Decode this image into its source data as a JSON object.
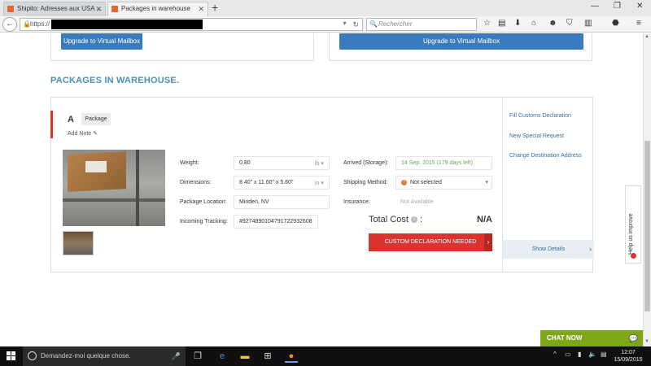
{
  "browser": {
    "tabs": [
      {
        "label": "Shipito: Adresses aux USA ..."
      },
      {
        "label": "Packages in warehouse"
      }
    ],
    "url_prefix": "https://",
    "search_placeholder": "Rechercher"
  },
  "page": {
    "upgrade_buttons": [
      "Upgrade to Virtual Mailbox",
      "Upgrade to Virtual Mailbox"
    ],
    "section_title": "PACKAGES IN WAREHOUSE.",
    "package": {
      "letter": "A",
      "type": "Package",
      "add_note": "Add Note",
      "fields": {
        "weight_label": "Weight:",
        "weight_value": "0.80",
        "weight_unit": "lb",
        "dimensions_label": "Dimensions:",
        "dimensions_value": "8.40\" x 11.60\" x 5.60\"",
        "dimensions_unit": "in",
        "location_label": "Package Location:",
        "location_value": "Minden, NV",
        "tracking_label": "Incoming Tracking:",
        "tracking_value": "#9274890104791722932608",
        "arrived_label": "Arrived (Storage):",
        "arrived_value": "14 Sep. 2015 (179 days left)",
        "shipping_label": "Shipping Method:",
        "shipping_value": "Not selected",
        "insurance_label": "Insurance:",
        "insurance_value": "Not Available"
      },
      "total_cost_label": "Total Cost",
      "total_cost_value": "N/A",
      "custom_button": "CUSTOM DECLARATION NEEDED",
      "right_links": [
        "Fill Customs Declaration",
        "New Special Request",
        "Change Destination Address"
      ],
      "show_details": "Show Details"
    },
    "help_tab": "Help us improve",
    "chat": "CHAT NOW"
  },
  "taskbar": {
    "search_placeholder": "Demandez-moi quelque chose.",
    "time": "12:07",
    "date": "15/09/2015"
  },
  "colors": {
    "accent_blue": "#3a7bbf",
    "title_blue": "#4b8fc1",
    "alert_red": "#d9342f",
    "chat_green": "#7fa617",
    "arrived_green": "#6aa84f"
  }
}
